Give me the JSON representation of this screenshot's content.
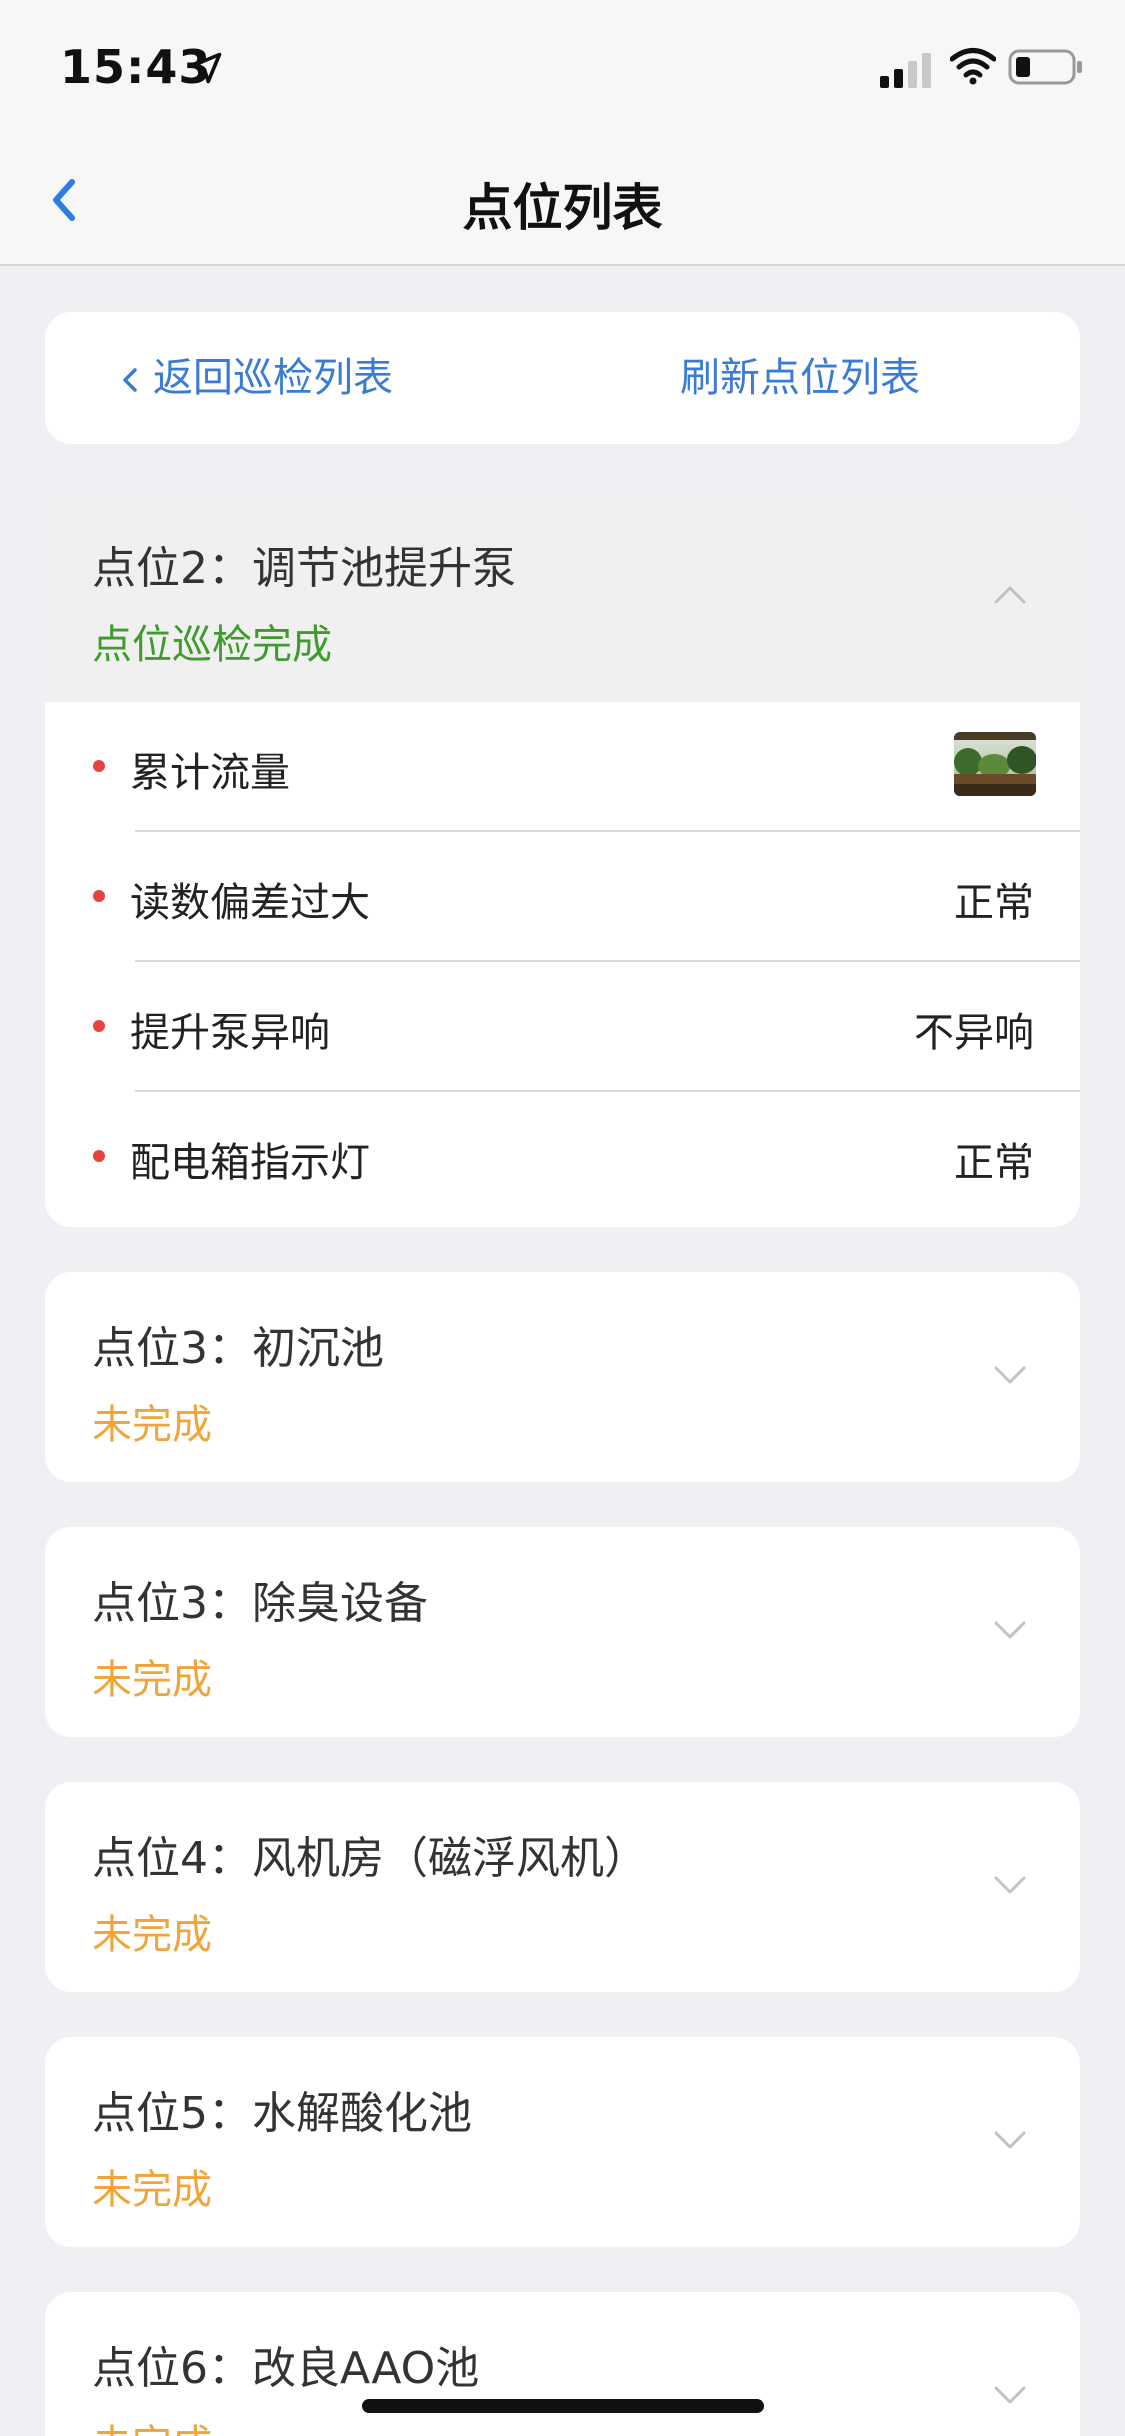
{
  "status_bar": {
    "time": "15:43",
    "icons": [
      "location-arrow-icon",
      "cellular-signal-icon",
      "wifi-icon",
      "battery-icon"
    ]
  },
  "nav": {
    "title": "点位列表",
    "back_icon": "chevron-left-icon"
  },
  "actions": {
    "back_label": "返回巡检列表",
    "refresh_label": "刷新点位列表"
  },
  "colors": {
    "accent": "#3a7bd5",
    "done": "#3f9b2d",
    "pending": "#f0a43a",
    "required_dot": "#e64340",
    "background": "#efeff4"
  },
  "points": [
    {
      "title": "点位2：调节池提升泵",
      "status": "点位巡检完成",
      "expanded": true,
      "items": [
        {
          "label": "累计流量",
          "value": "",
          "thumbnail": "photo-thumbnail"
        },
        {
          "label": "读数偏差过大",
          "value": "正常"
        },
        {
          "label": "提升泵异响",
          "value": "不异响"
        },
        {
          "label": "配电箱指示灯",
          "value": "正常"
        }
      ]
    },
    {
      "title": "点位3：初沉池",
      "status": "未完成",
      "expanded": false
    },
    {
      "title": "点位3：除臭设备",
      "status": "未完成",
      "expanded": false
    },
    {
      "title": "点位4：风机房（磁浮风机）",
      "status": "未完成",
      "expanded": false
    },
    {
      "title": "点位5：水解酸化池",
      "status": "未完成",
      "expanded": false
    },
    {
      "title": "点位6：改良AAO池",
      "status": "未完成",
      "expanded": false
    }
  ]
}
